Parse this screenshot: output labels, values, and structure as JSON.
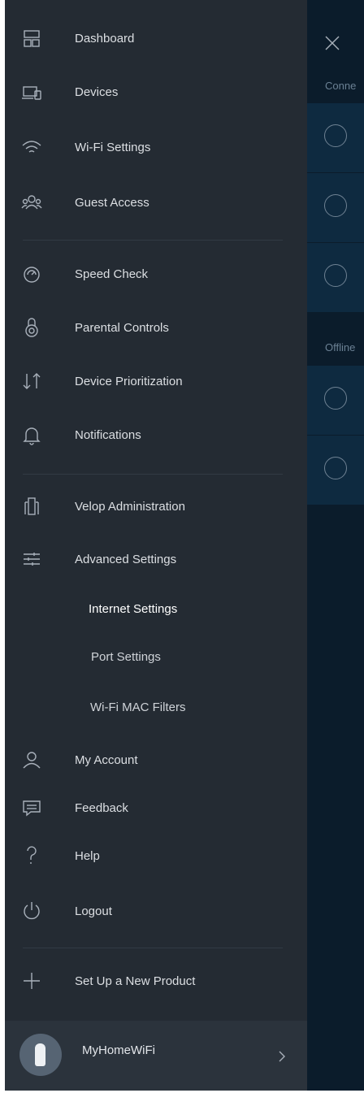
{
  "background": {
    "sections": [
      {
        "header": "Conne",
        "items": 3
      },
      {
        "header": "Offline",
        "items": 2
      }
    ]
  },
  "menu": {
    "items": [
      {
        "label": "Dashboard",
        "icon": "dashboard-icon"
      },
      {
        "label": "Devices",
        "icon": "devices-icon"
      },
      {
        "label": "Wi-Fi Settings",
        "icon": "wifi-icon"
      },
      {
        "label": "Guest Access",
        "icon": "guest-access-icon"
      },
      {
        "label": "Speed Check",
        "icon": "speedometer-icon"
      },
      {
        "label": "Parental Controls",
        "icon": "lock-icon"
      },
      {
        "label": "Device Prioritization",
        "icon": "priority-arrows-icon"
      },
      {
        "label": "Notifications",
        "icon": "bell-icon"
      },
      {
        "label": "Velop Administration",
        "icon": "velop-admin-icon"
      },
      {
        "label": "Advanced Settings",
        "icon": "sliders-icon"
      },
      {
        "label": "My Account",
        "icon": "person-icon"
      },
      {
        "label": "Feedback",
        "icon": "chat-icon"
      },
      {
        "label": "Help",
        "icon": "question-icon"
      },
      {
        "label": "Logout",
        "icon": "power-icon"
      },
      {
        "label": "Set Up a New Product",
        "icon": "plus-icon"
      }
    ],
    "advanced_sub_items": [
      {
        "label": "Internet Settings",
        "active": true
      },
      {
        "label": "Port Settings",
        "active": false
      },
      {
        "label": "Wi-Fi MAC Filters",
        "active": false
      }
    ]
  },
  "footer": {
    "network_name": "MyHomeWiFi",
    "icon": "velop-node-icon"
  },
  "colors": {
    "menu_bg": "#242b33",
    "footer_bg": "#2b333c",
    "panel_bg": "#0b1c2b",
    "band_bg": "#0e2a40",
    "text": "#dcdfe3"
  }
}
